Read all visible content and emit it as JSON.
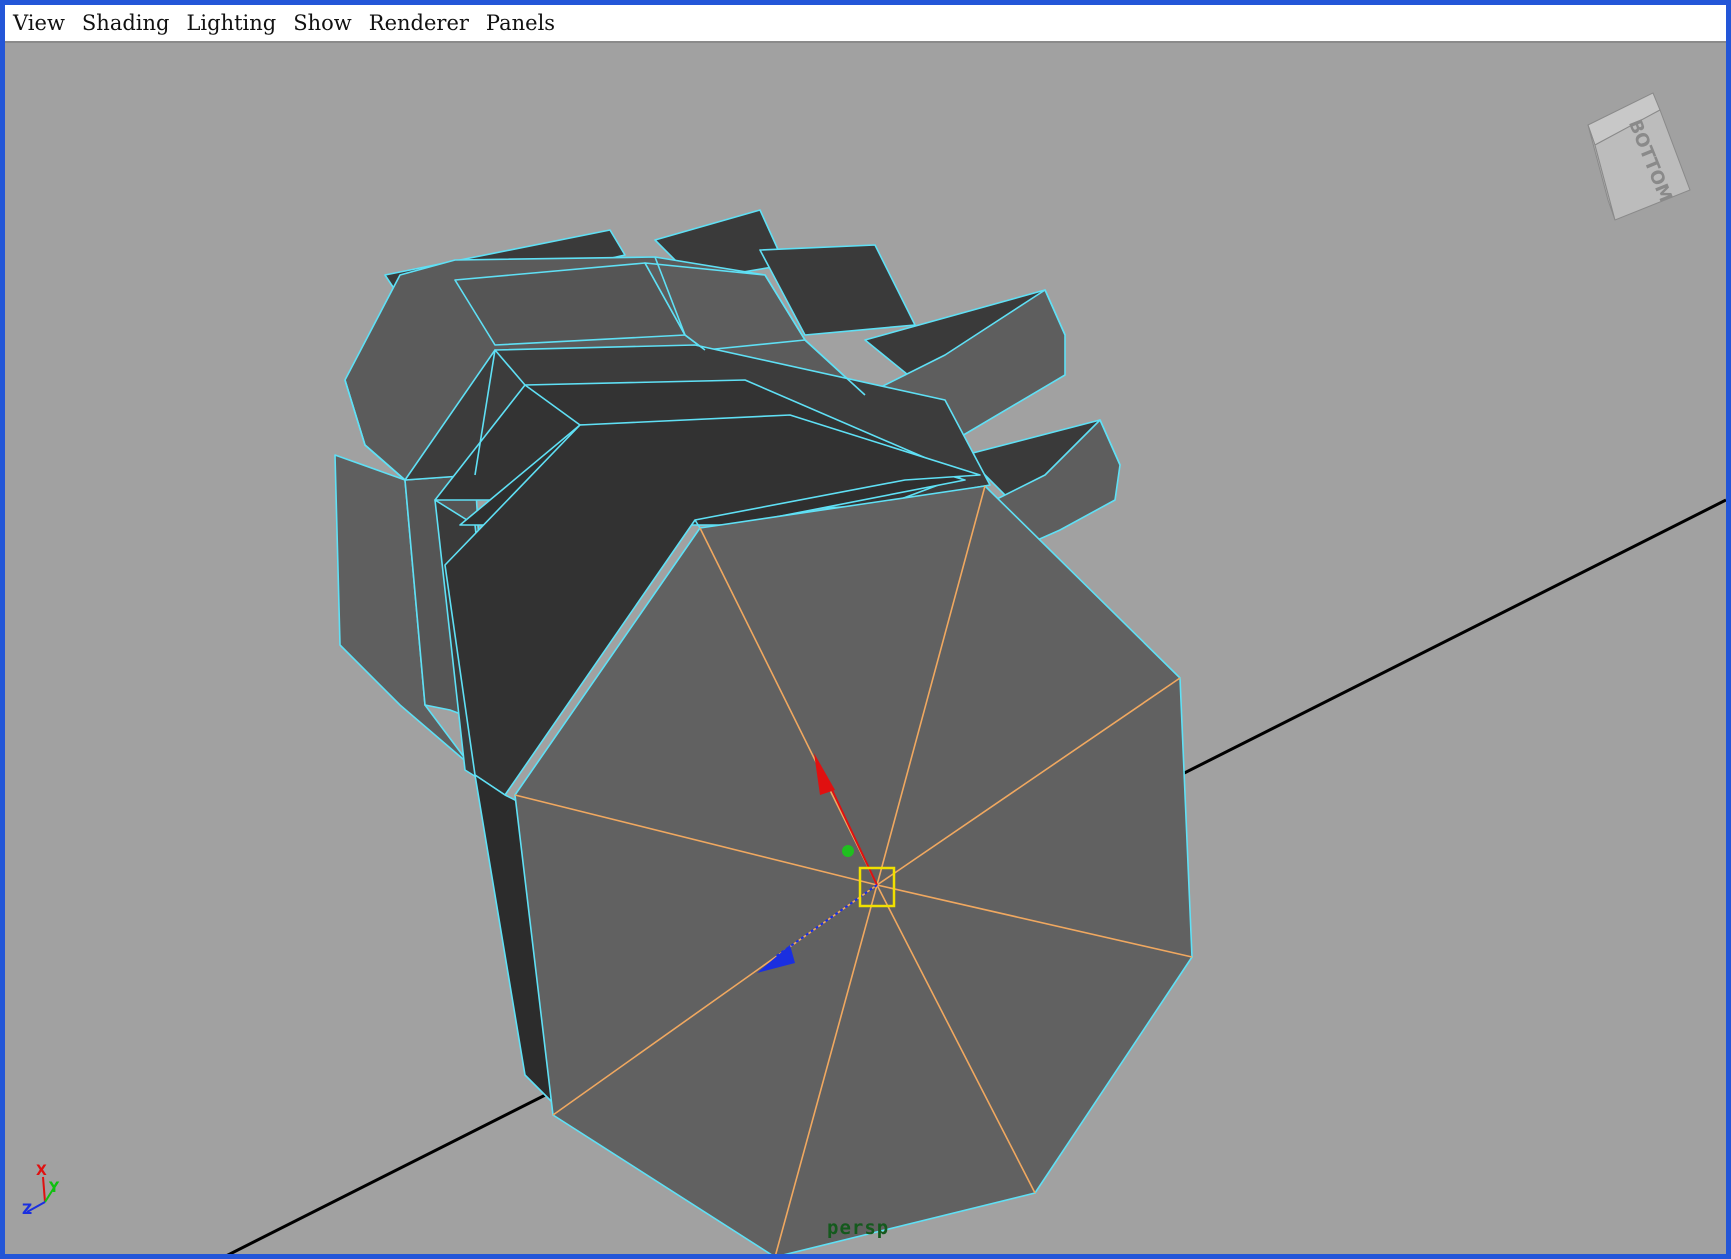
{
  "menubar": {
    "items": [
      "View",
      "Shading",
      "Lighting",
      "Show",
      "Renderer",
      "Panels"
    ]
  },
  "viewport": {
    "camera_label": "persp",
    "viewcube_face": "BOTTOM",
    "background_color": "#a1a1a1",
    "wireframe_color": "#5fe0f5",
    "selected_edge_color": "#f0a860"
  },
  "axis_indicator": {
    "x_label": "X",
    "y_label": "Y",
    "z_label": "Z",
    "x_color": "#e01010",
    "y_color": "#10c010",
    "z_color": "#1a2fe0"
  }
}
